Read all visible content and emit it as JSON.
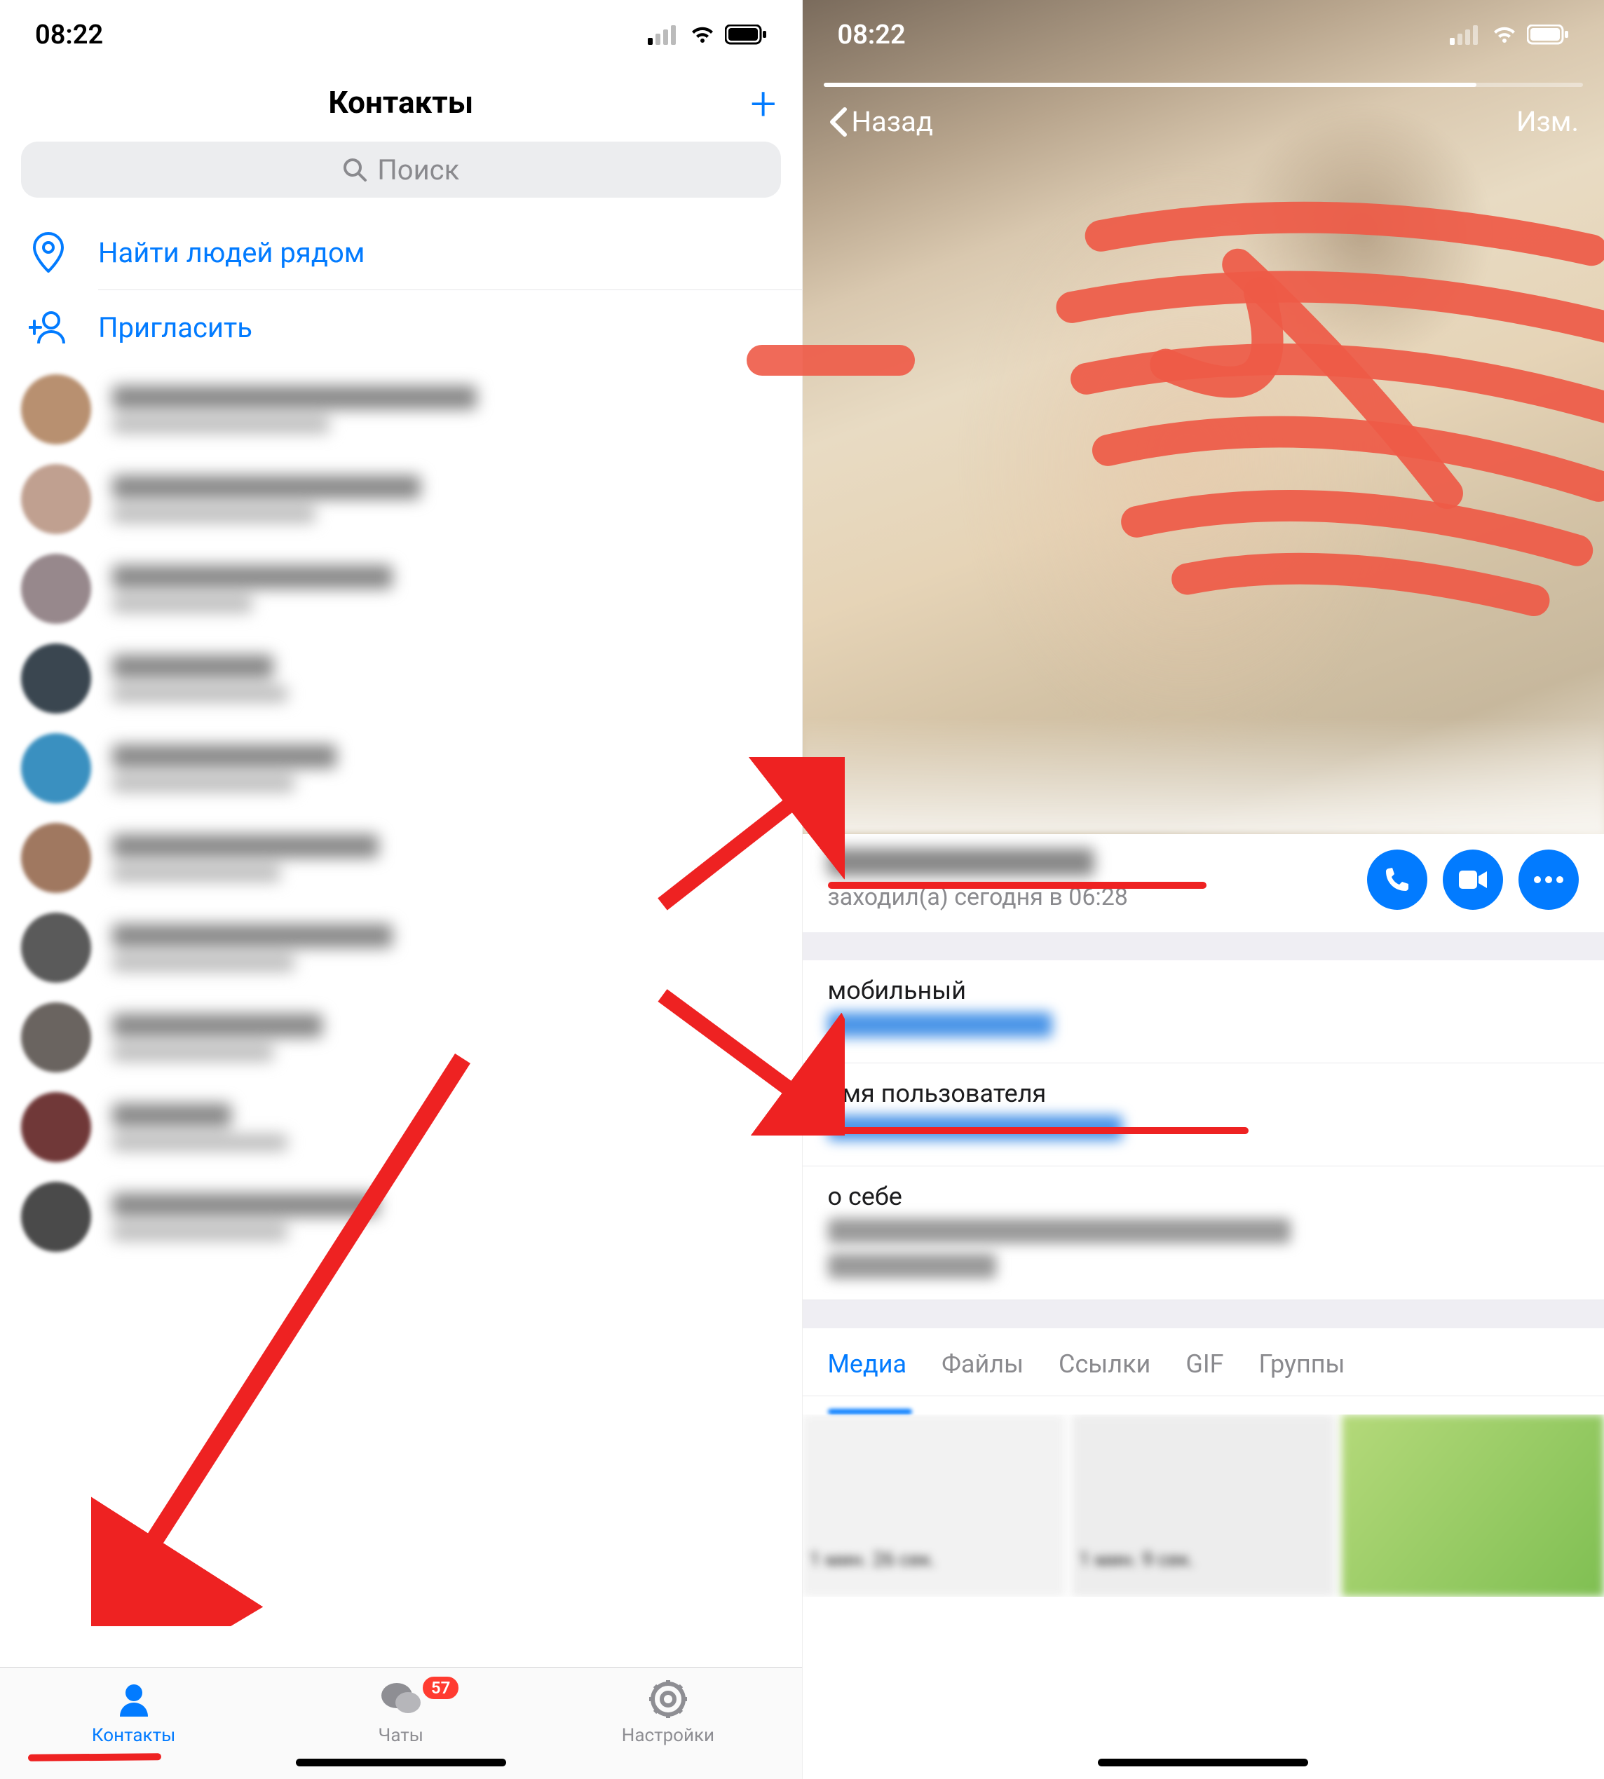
{
  "status": {
    "time": "08:22"
  },
  "left": {
    "title": "Контакты",
    "search_placeholder": "Поиск",
    "action_nearby": "Найти людей рядом",
    "action_invite": "Пригласить",
    "tabs": {
      "contacts": "Контакты",
      "chats": "Чаты",
      "settings": "Настройки",
      "badge": "57"
    },
    "contacts": [
      {
        "name_w": 520,
        "status_w": 310
      },
      {
        "name_w": 440,
        "status_w": 290
      },
      {
        "name_w": 400,
        "status_w": 200
      },
      {
        "name_w": 230,
        "status_w": 250
      },
      {
        "name_w": 320,
        "status_w": 260
      },
      {
        "name_w": 380,
        "status_w": 240
      },
      {
        "name_w": 400,
        "status_w": 260
      },
      {
        "name_w": 300,
        "status_w": 230
      },
      {
        "name_w": 170,
        "status_w": 250
      },
      {
        "name_w": 380,
        "status_w": 250
      }
    ],
    "avatar_colors": [
      "#b89070",
      "#c0a090",
      "#97888c",
      "#3a4650",
      "#3a90c0",
      "#a07860",
      "#5a5a5a",
      "#6a6460",
      "#703838",
      "#4a4a4a"
    ]
  },
  "right": {
    "nav_back": "Назад",
    "nav_edit": "Изм.",
    "last_seen": "заходил(а) сегодня в 06:28",
    "info": {
      "mobile_label": "мобильный",
      "username_label": "имя пользователя",
      "about_label": "о себе"
    },
    "media_tabs": [
      "Медиа",
      "Файлы",
      "Ссылки",
      "GIF",
      "Группы"
    ],
    "media_captions": [
      "1 мин. 26 сек.",
      "1 мин. 9 сек."
    ]
  }
}
